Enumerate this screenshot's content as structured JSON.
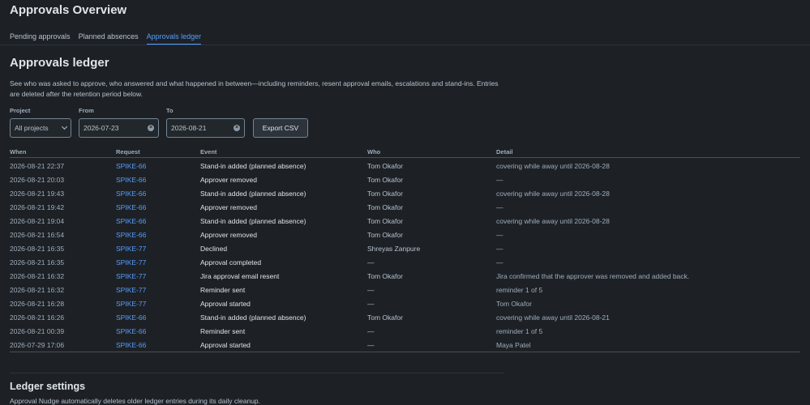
{
  "page_title": "Approvals Overview",
  "tabs": [
    {
      "label": "Pending approvals",
      "active": false
    },
    {
      "label": "Planned absences",
      "active": false
    },
    {
      "label": "Approvals ledger",
      "active": true
    }
  ],
  "ledger": {
    "title": "Approvals ledger",
    "description": "See who was asked to approve, who answered and what happened in between—including reminders, resent approval emails, escalations and stand-ins. Entries are deleted after the retention period below."
  },
  "filters": {
    "project_label": "Project",
    "project_value": "All projects",
    "from_label": "From",
    "from_value": "2026-07-23",
    "to_label": "To",
    "to_value": "2026-08-21",
    "export_label": "Export CSV"
  },
  "table": {
    "headers": {
      "when": "When",
      "request": "Request",
      "event": "Event",
      "who": "Who",
      "detail": "Detail"
    },
    "rows": [
      {
        "when": "2026-08-21 22:37",
        "request": "SPIKE-66",
        "event": "Stand-in added (planned absence)",
        "who": "Tom Okafor",
        "detail": "covering while away until 2026-08-28"
      },
      {
        "when": "2026-08-21 20:03",
        "request": "SPIKE-66",
        "event": "Approver removed",
        "who": "Tom Okafor",
        "detail": "—"
      },
      {
        "when": "2026-08-21 19:43",
        "request": "SPIKE-66",
        "event": "Stand-in added (planned absence)",
        "who": "Tom Okafor",
        "detail": "covering while away until 2026-08-28"
      },
      {
        "when": "2026-08-21 19:42",
        "request": "SPIKE-66",
        "event": "Approver removed",
        "who": "Tom Okafor",
        "detail": "—"
      },
      {
        "when": "2026-08-21 19:04",
        "request": "SPIKE-66",
        "event": "Stand-in added (planned absence)",
        "who": "Tom Okafor",
        "detail": "covering while away until 2026-08-28"
      },
      {
        "when": "2026-08-21 16:54",
        "request": "SPIKE-66",
        "event": "Approver removed",
        "who": "Tom Okafor",
        "detail": "—"
      },
      {
        "when": "2026-08-21 16:35",
        "request": "SPIKE-77",
        "event": "Declined",
        "who": "Shreyas Zanpure",
        "detail": "—"
      },
      {
        "when": "2026-08-21 16:35",
        "request": "SPIKE-77",
        "event": "Approval completed",
        "who": "—",
        "detail": "—"
      },
      {
        "when": "2026-08-21 16:32",
        "request": "SPIKE-77",
        "event": "Jira approval email resent",
        "who": "Tom Okafor",
        "detail": "Jira confirmed that the approver was removed and added back."
      },
      {
        "when": "2026-08-21 16:32",
        "request": "SPIKE-77",
        "event": "Reminder sent",
        "who": "—",
        "detail": "reminder 1 of 5"
      },
      {
        "when": "2026-08-21 16:28",
        "request": "SPIKE-77",
        "event": "Approval started",
        "who": "—",
        "detail": "Tom Okafor"
      },
      {
        "when": "2026-08-21 16:26",
        "request": "SPIKE-66",
        "event": "Stand-in added (planned absence)",
        "who": "Tom Okafor",
        "detail": "covering while away until 2026-08-21"
      },
      {
        "when": "2026-08-21 00:39",
        "request": "SPIKE-66",
        "event": "Reminder sent",
        "who": "—",
        "detail": "reminder 1 of 5"
      },
      {
        "when": "2026-07-29 17:06",
        "request": "SPIKE-66",
        "event": "Approval started",
        "who": "—",
        "detail": "Maya Patel"
      }
    ]
  },
  "settings": {
    "title": "Ledger settings",
    "description": "Approval Nudge automatically deletes older ledger entries during its daily cleanup."
  },
  "colors": {
    "background": "#1d2125",
    "link": "#579dff",
    "text": "#b6c2cf",
    "heading": "#dee4ea"
  }
}
